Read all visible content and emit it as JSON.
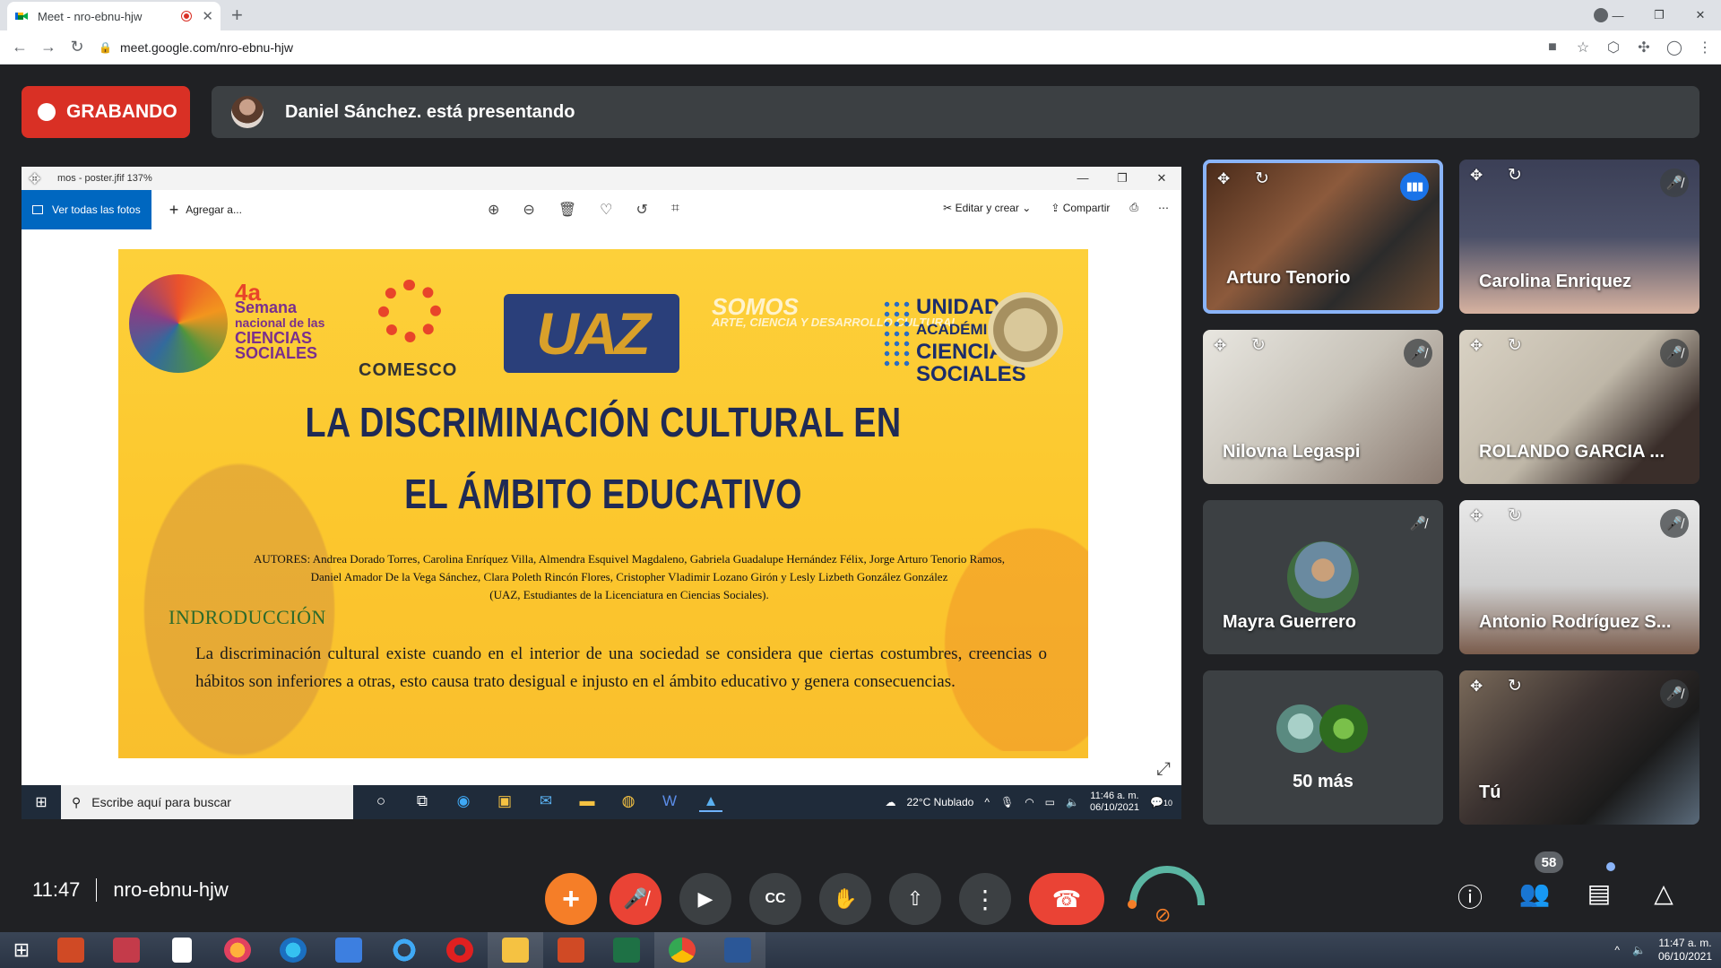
{
  "browser": {
    "tab_title": "Meet - nro-ebnu-hjw",
    "tab_close": "✕",
    "new_tab": "+",
    "url": "meet.google.com/nro-ebnu-hjw",
    "window_controls": [
      "—",
      "❐",
      "✕"
    ]
  },
  "meet": {
    "recording_label": "GRABANDO",
    "presenting_text": "Daniel Sánchez. está presentando",
    "time": "11:47",
    "meeting_code": "nro-ebnu-hjw",
    "participants_count": "58"
  },
  "shared_screen": {
    "photos_title": "mos - poster.jfif   137%",
    "toolbar": {
      "ver_todas": "Ver todas las fotos",
      "agregar": "Agregar a...",
      "editar": "Editar y crear",
      "compartir": "Compartir"
    },
    "slide": {
      "event_number": "4a",
      "event_name_lines": [
        "Semana",
        "nacional de las",
        "CIENCIAS",
        "SOCIALES"
      ],
      "comesco": "COMESCO",
      "uaz": "UAZ",
      "somos": "SOMOS",
      "somos_sub": "ARTE, CIENCIA Y DESARROLLO CULTURAL",
      "unidad_lines": [
        "UNIDAD",
        "ACADÉMICA DE",
        "CIENCIAS",
        "SOCIALES"
      ],
      "title_line1": "LA DISCRIMINACIÓN CULTURAL EN",
      "title_line2": "EL ÁMBITO EDUCATIVO",
      "authors_line1": "AUTORES: Andrea Dorado Torres, Carolina Enríquez Villa, Almendra Esquivel Magdaleno, Gabriela Guadalupe Hernández Félix, Jorge Arturo Tenorio Ramos,",
      "authors_line2": "Daniel Amador De la Vega Sánchez, Clara Poleth Rincón Flores, Cristopher Vladimir Lozano Girón y Lesly Lizbeth González González",
      "authors_line3": "(UAZ, Estudiantes de la Licenciatura en Ciencias Sociales).",
      "intro_heading": "INDRODUCCIÓN",
      "intro_text": "La discriminación cultural existe cuando en el interior de una sociedad se considera que ciertas costumbres, creencias o hábitos son inferiores a otras, esto causa trato desigual e injusto en el ámbito educativo y genera consecuencias."
    },
    "taskbar": {
      "search_placeholder": "Escribe aquí para buscar",
      "weather": "22°C  Nublado",
      "clock_time": "11:46 a. m.",
      "clock_date": "06/10/2021",
      "notif_count": "10"
    }
  },
  "participants": [
    {
      "name": "Arturo Tenorio",
      "state": "speaking"
    },
    {
      "name": "Carolina Enriquez",
      "state": "muted"
    },
    {
      "name": "Nilovna Legaspi",
      "state": "muted"
    },
    {
      "name": "ROLANDO GARCIA ...",
      "state": "muted"
    },
    {
      "name": "Mayra Guerrero",
      "state": "muted"
    },
    {
      "name": "Antonio Rodríguez S...",
      "state": "muted"
    },
    {
      "name": "50 más",
      "state": "group"
    },
    {
      "name": "Tú",
      "state": "muted"
    }
  ],
  "os": {
    "clock_time": "11:47 a. m.",
    "clock_date": "06/10/2021"
  },
  "colors": {
    "meet_bg": "#202124",
    "recording_red": "#d93025",
    "hangup_red": "#ea4335",
    "add_orange": "#f57e28",
    "active_speaker_blue": "#8ab4f8",
    "slide_yellow": "#fcc72d"
  },
  "icons": {
    "mute": "mic-off-icon",
    "speaking": "audio-level-icon",
    "move": "move-icon",
    "refresh": "refresh-icon"
  }
}
